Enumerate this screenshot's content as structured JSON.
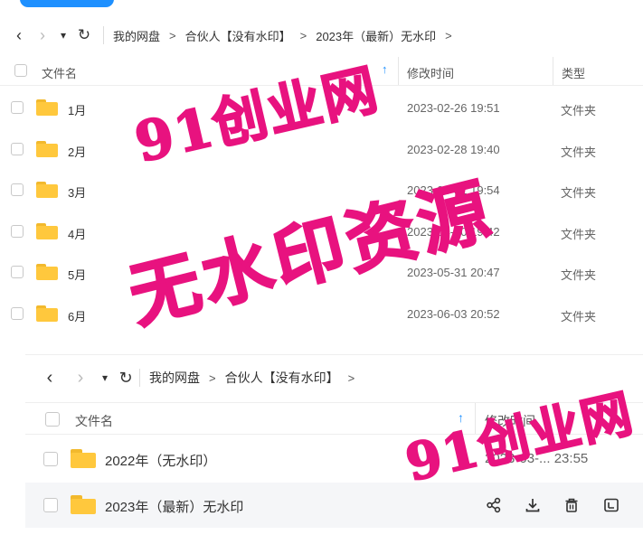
{
  "panel1": {
    "nav": {
      "back": "‹",
      "forward": "›",
      "dropdown": "▾",
      "refresh": "↻"
    },
    "breadcrumbs": [
      "我的网盘",
      "合伙人【没有水印】",
      "2023年（最新）无水印"
    ],
    "crumb_sep": ">",
    "headers": {
      "name": "文件名",
      "sort": "↑",
      "time": "修改时间",
      "type": "类型"
    },
    "rows": [
      {
        "name": "1月",
        "time": "2023-02-26 19:51",
        "type": "文件夹"
      },
      {
        "name": "2月",
        "time": "2023-02-28 19:40",
        "type": "文件夹"
      },
      {
        "name": "3月",
        "time": "2023-03-31 19:54",
        "type": "文件夹"
      },
      {
        "name": "4月",
        "time": "2023-04-30 19:42",
        "type": "文件夹"
      },
      {
        "name": "5月",
        "time": "2023-05-31 20:47",
        "type": "文件夹"
      },
      {
        "name": "6月",
        "time": "2023-06-03 20:52",
        "type": "文件夹"
      }
    ]
  },
  "panel2": {
    "breadcrumbs": [
      "我的网盘",
      "合伙人【没有水印】"
    ],
    "crumb_sep": ">",
    "headers": {
      "name": "文件名",
      "sort": "↑",
      "time": "修改时间"
    },
    "rows": [
      {
        "name": "2022年（无水印）",
        "time": "2023-03-... 23:55"
      },
      {
        "name": "2023年（最新）无水印",
        "time": ""
      }
    ]
  },
  "watermarks": [
    "91创业网",
    "无水印资源",
    "91创业网"
  ],
  "colors": {
    "accent": "#1e90ff",
    "folder": "#ffc83d",
    "watermark": "#e8127f"
  }
}
